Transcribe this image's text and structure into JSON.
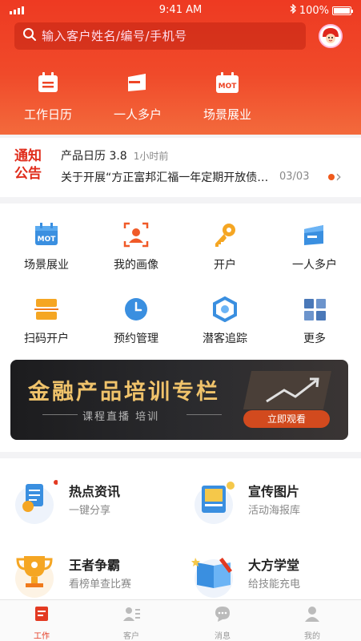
{
  "status_bar": {
    "time": "9:41 AM",
    "battery": "100%"
  },
  "search": {
    "placeholder": "输入客户姓名/编号/手机号"
  },
  "header_actions": [
    {
      "label": "工作日历",
      "icon": "calendar-icon"
    },
    {
      "label": "一人多户",
      "icon": "card-wallet-icon"
    },
    {
      "label": "场景展业",
      "icon": "mot-calendar-icon"
    }
  ],
  "notice": {
    "tag_line1": "通知",
    "tag_line2": "公告",
    "title": "产品日历 3.8",
    "time_ago": "1小时前",
    "content": "关于开展“方正富邦汇福一年定期开放债券型基金”",
    "page": "03/03"
  },
  "grid": [
    {
      "label": "场景展业",
      "icon": "mot-icon"
    },
    {
      "label": "我的画像",
      "icon": "portrait-icon"
    },
    {
      "label": "开户",
      "icon": "key-icon"
    },
    {
      "label": "一人多户",
      "icon": "card-icon"
    },
    {
      "label": "扫码开户",
      "icon": "scan-icon"
    },
    {
      "label": "预约管理",
      "icon": "clock-icon"
    },
    {
      "label": "潜客追踪",
      "icon": "track-icon"
    },
    {
      "label": "更多",
      "icon": "more-grid-icon"
    }
  ],
  "banner": {
    "title": "金融产品培训专栏",
    "subtitle": "课程直播 培训",
    "button": "立即观看"
  },
  "features": [
    {
      "title": "热点资讯",
      "subtitle": "一键分享",
      "icon": "news-icon"
    },
    {
      "title": "宣传图片",
      "subtitle": "活动海报库",
      "icon": "poster-icon"
    },
    {
      "title": "王者争霸",
      "subtitle": "看榜单查比赛",
      "icon": "trophy-icon"
    },
    {
      "title": "大方学堂",
      "subtitle": "给技能充电",
      "icon": "book-icon"
    }
  ],
  "tabbar": [
    {
      "label": "工作",
      "icon": "work-icon",
      "active": true
    },
    {
      "label": "客户",
      "icon": "customer-icon",
      "active": false
    },
    {
      "label": "消息",
      "icon": "message-icon",
      "active": false
    },
    {
      "label": "我的",
      "icon": "profile-icon",
      "active": false
    }
  ],
  "colors": {
    "brand": "#ee3a22",
    "accent_orange": "#f5a623",
    "accent_blue": "#3a8fe0",
    "gold": "#f0c36b"
  }
}
